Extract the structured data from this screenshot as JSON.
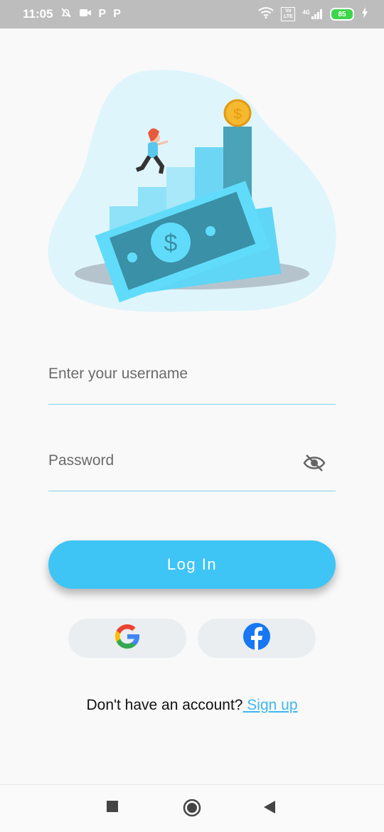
{
  "status_bar": {
    "time": "11:05",
    "p1": "P",
    "p2": "P",
    "battery": "85",
    "network": "4G",
    "volte": "Vo LTE"
  },
  "login": {
    "username_placeholder": "Enter your username",
    "password_placeholder": "Password",
    "login_label": "Log In",
    "signup_prompt": "Don't have an account?",
    "signup_link": " Sign up"
  },
  "social": {
    "google_icon": "google-logo-icon",
    "facebook_icon": "facebook-logo-icon"
  },
  "colors": {
    "accent": "#3fc4f6",
    "link": "#3fb8ee",
    "blob": "#dff5fc",
    "facebook": "#1877f2"
  }
}
